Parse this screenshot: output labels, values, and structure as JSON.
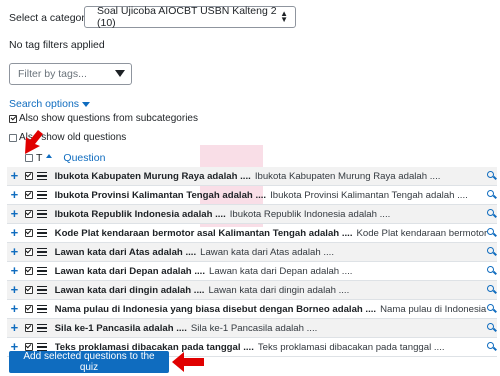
{
  "category": {
    "label": "Select a category:",
    "selected": "Soal Ujicoba AIOCBT USBN Kalteng 2 (10)"
  },
  "no_tag_filters": "No tag filters applied",
  "tag_filter": {
    "placeholder": "Filter by tags..."
  },
  "search_options_label": "Search options",
  "checkboxes": {
    "subcategories": {
      "label": "Also show questions from subcategories",
      "checked": true
    },
    "old_questions": {
      "label": "Also show old questions",
      "checked": false
    }
  },
  "table": {
    "type_header": "T",
    "question_header": "Question",
    "rows": [
      {
        "name": "Ibukota Kabupaten Murung Raya adalah ....",
        "text": "Ibukota Kabupaten Murung Raya adalah ...."
      },
      {
        "name": "Ibukota Provinsi Kalimantan Tengah adalah ....",
        "text": "Ibukota Provinsi Kalimantan Tengah adalah ...."
      },
      {
        "name": "Ibukota Republik Indonesia adalah ....",
        "text": "Ibukota Republik Indonesia adalah ...."
      },
      {
        "name": "Kode Plat kendaraan bermotor asal Kalimantan Tengah adalah ....",
        "text": "Kode Plat kendaraan bermotor"
      },
      {
        "name": "Lawan kata dari Atas adalah ....",
        "text": "Lawan kata dari Atas adalah ...."
      },
      {
        "name": "Lawan kata dari Depan adalah ....",
        "text": "Lawan kata dari Depan adalah ...."
      },
      {
        "name": "Lawan kata dari dingin adalah ....",
        "text": "Lawan kata dari dingin adalah ...."
      },
      {
        "name": "Nama pulau di Indonesia yang biasa disebut dengan Borneo adalah ....",
        "text": "Nama pulau di Indonesia"
      },
      {
        "name": "Sila ke-1 Pancasila adalah ....",
        "text": "Sila ke-1 Pancasila adalah ...."
      },
      {
        "name": "Teks proklamasi dibacakan pada tanggal ....",
        "text": "Teks proklamasi dibacakan pada tanggal ...."
      }
    ]
  },
  "add_button_label": "Add selected questions to the quiz",
  "colors": {
    "accent": "#0f6cbf",
    "arrow": "#e00000"
  }
}
